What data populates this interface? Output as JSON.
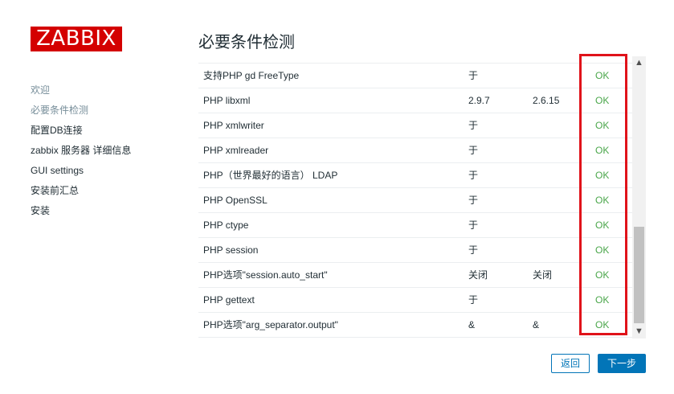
{
  "brand": {
    "logo_text": "ZABBIX",
    "accent": "#d40000"
  },
  "nav": {
    "items": [
      {
        "label": "欢迎",
        "state": "done"
      },
      {
        "label": "必要条件检测",
        "state": "current"
      },
      {
        "label": "配置DB连接",
        "state": "todo"
      },
      {
        "label": "zabbix 服务器 详细信息",
        "state": "todo"
      },
      {
        "label": "GUI settings",
        "state": "todo"
      },
      {
        "label": "安装前汇总",
        "state": "todo"
      },
      {
        "label": "安装",
        "state": "todo"
      }
    ]
  },
  "page": {
    "title": "必要条件检测"
  },
  "table": {
    "rows": [
      {
        "name": "支持PHP gd FreeType",
        "current": "于",
        "required": "",
        "result": "OK"
      },
      {
        "name": "PHP libxml",
        "current": "2.9.7",
        "required": "2.6.15",
        "result": "OK"
      },
      {
        "name": "PHP xmlwriter",
        "current": "于",
        "required": "",
        "result": "OK"
      },
      {
        "name": "PHP xmlreader",
        "current": "于",
        "required": "",
        "result": "OK"
      },
      {
        "name": "PHP（世界最好的语言） LDAP",
        "current": "于",
        "required": "",
        "result": "OK"
      },
      {
        "name": "PHP OpenSSL",
        "current": "于",
        "required": "",
        "result": "OK"
      },
      {
        "name": "PHP ctype",
        "current": "于",
        "required": "",
        "result": "OK"
      },
      {
        "name": "PHP session",
        "current": "于",
        "required": "",
        "result": "OK"
      },
      {
        "name": "PHP选项\"session.auto_start\"",
        "current": "关闭",
        "required": "关闭",
        "result": "OK"
      },
      {
        "name": "PHP gettext",
        "current": "于",
        "required": "",
        "result": "OK"
      },
      {
        "name": "PHP选项\"arg_separator.output\"",
        "current": "&",
        "required": "&",
        "result": "OK"
      }
    ],
    "ok_color": "#4aa64a"
  },
  "annotation": {
    "highlight_color": "#e0131a"
  },
  "scrollbar": {
    "up_icon": "chevron-up-icon",
    "down_icon": "chevron-down-icon"
  },
  "buttons": {
    "back_label": "返回",
    "next_label": "下一步",
    "primary_color": "#0275b8"
  }
}
